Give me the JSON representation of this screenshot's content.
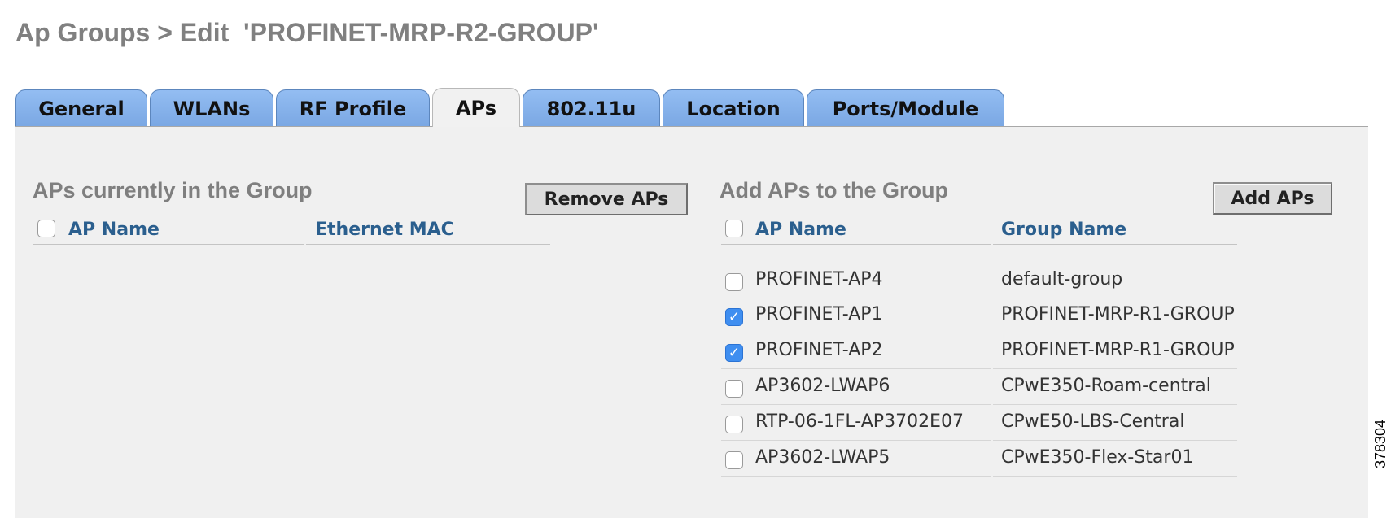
{
  "page": {
    "title": "Ap Groups > Edit  'PROFINET-MRP-R2-GROUP'",
    "side_id": "378304"
  },
  "tabs": [
    {
      "label": "General",
      "active": false
    },
    {
      "label": "WLANs",
      "active": false
    },
    {
      "label": "RF Profile",
      "active": false
    },
    {
      "label": "APs",
      "active": true
    },
    {
      "label": "802.11u",
      "active": false
    },
    {
      "label": "Location",
      "active": false
    },
    {
      "label": "Ports/Module",
      "active": false
    }
  ],
  "current": {
    "title": "APs currently in the Group",
    "button": "Remove APs",
    "columns": [
      "AP Name",
      "Ethernet MAC"
    ],
    "rows": []
  },
  "add": {
    "title": "Add APs to the Group",
    "button": "Add APs",
    "columns": [
      "AP Name",
      "Group Name"
    ],
    "rows": [
      {
        "checked": false,
        "ap_name": "PROFINET-AP4",
        "group": "default-group"
      },
      {
        "checked": true,
        "ap_name": "PROFINET-AP1",
        "group": "PROFINET-MRP-R1-GROUP"
      },
      {
        "checked": true,
        "ap_name": "PROFINET-AP2",
        "group": "PROFINET-MRP-R1-GROUP"
      },
      {
        "checked": false,
        "ap_name": "AP3602-LWAP6",
        "group": "CPwE350-Roam-central"
      },
      {
        "checked": false,
        "ap_name": "RTP-06-1FL-AP3702E07",
        "group": "CPwE50-LBS-Central"
      },
      {
        "checked": false,
        "ap_name": "AP3602-LWAP5",
        "group": "CPwE350-Flex-Star01"
      }
    ]
  },
  "colors": {
    "tab_bg": "#7aa7e3",
    "header_text": "#2b5f8e",
    "checkbox_checked": "#3f8ef0"
  }
}
